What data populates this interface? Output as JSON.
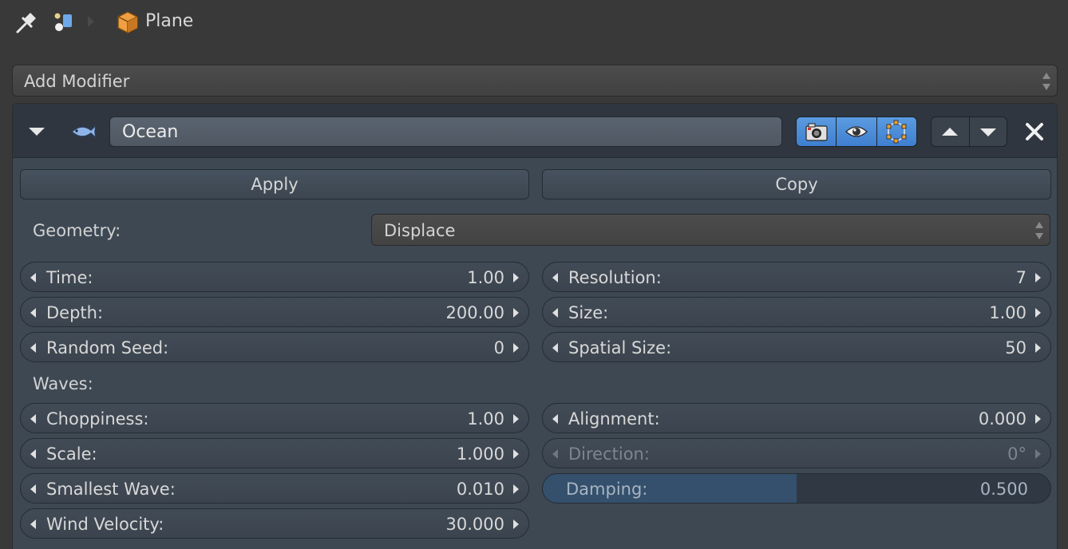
{
  "header": {
    "object_name": "Plane"
  },
  "add_modifier": {
    "label": "Add Modifier"
  },
  "modifier": {
    "name": "Ocean",
    "apply_label": "Apply",
    "copy_label": "Copy",
    "geometry": {
      "label": "Geometry:",
      "value": "Displace"
    },
    "fields_left": [
      {
        "label": "Time:",
        "value": "1.00"
      },
      {
        "label": "Depth:",
        "value": "200.00"
      },
      {
        "label": "Random Seed:",
        "value": "0"
      }
    ],
    "fields_right": [
      {
        "label": "Resolution:",
        "value": "7"
      },
      {
        "label": "Size:",
        "value": "1.00"
      },
      {
        "label": "Spatial Size:",
        "value": "50"
      }
    ],
    "waves": {
      "label": "Waves:",
      "fields_left": [
        {
          "label": "Choppiness:",
          "value": "1.00"
        },
        {
          "label": "Scale:",
          "value": "1.000"
        },
        {
          "label": "Smallest Wave:",
          "value": "0.010"
        },
        {
          "label": "Wind Velocity:",
          "value": "30.000"
        }
      ],
      "fields_right": [
        {
          "label": "Alignment:",
          "value": "0.000"
        },
        {
          "label": "Direction:",
          "value": "0°"
        }
      ],
      "damping": {
        "label": "Damping:",
        "value": "0.500",
        "fraction": 0.5
      }
    }
  },
  "colors": {
    "accent": "#4a8ad8",
    "panel": "#3d4853",
    "background": "#393939"
  }
}
